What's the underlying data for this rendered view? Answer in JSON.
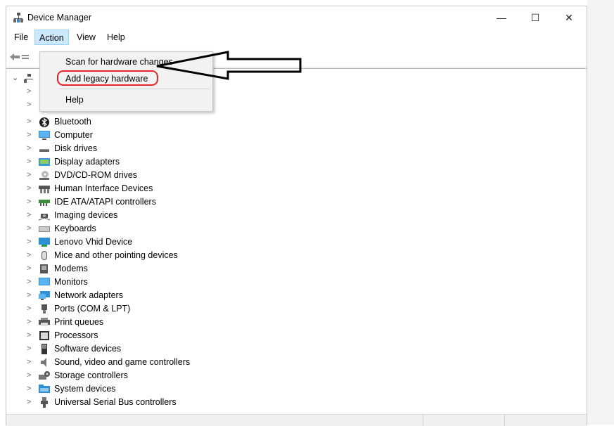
{
  "window": {
    "title": "Device Manager",
    "controls": {
      "minimize": "—",
      "maximize": "☐",
      "close": "✕"
    }
  },
  "menubar": {
    "items": [
      "File",
      "Action",
      "View",
      "Help"
    ],
    "active": "Action"
  },
  "dropdown": {
    "items": [
      "Scan for hardware changes",
      "Add legacy hardware",
      "Help"
    ],
    "highlighted": "Add legacy hardware"
  },
  "tree": {
    "items": [
      {
        "label": "Bluetooth",
        "icon": "bluetooth-icon"
      },
      {
        "label": "Computer",
        "icon": "computer-icon"
      },
      {
        "label": "Disk drives",
        "icon": "disk-drive-icon"
      },
      {
        "label": "Display adapters",
        "icon": "display-adapter-icon"
      },
      {
        "label": "DVD/CD-ROM drives",
        "icon": "dvd-drive-icon"
      },
      {
        "label": "Human Interface Devices",
        "icon": "hid-icon"
      },
      {
        "label": "IDE ATA/ATAPI controllers",
        "icon": "ide-controller-icon"
      },
      {
        "label": "Imaging devices",
        "icon": "imaging-device-icon"
      },
      {
        "label": "Keyboards",
        "icon": "keyboard-icon"
      },
      {
        "label": "Lenovo Vhid Device",
        "icon": "lenovo-device-icon"
      },
      {
        "label": "Mice and other pointing devices",
        "icon": "mouse-icon"
      },
      {
        "label": "Modems",
        "icon": "modem-icon"
      },
      {
        "label": "Monitors",
        "icon": "monitor-icon"
      },
      {
        "label": "Network adapters",
        "icon": "network-adapter-icon"
      },
      {
        "label": "Ports (COM & LPT)",
        "icon": "port-icon"
      },
      {
        "label": "Print queues",
        "icon": "printer-icon"
      },
      {
        "label": "Processors",
        "icon": "processor-icon"
      },
      {
        "label": "Software devices",
        "icon": "software-device-icon"
      },
      {
        "label": "Sound, video and game controllers",
        "icon": "speaker-icon"
      },
      {
        "label": "Storage controllers",
        "icon": "storage-controller-icon"
      },
      {
        "label": "System devices",
        "icon": "system-folder-icon"
      },
      {
        "label": "Universal Serial Bus controllers",
        "icon": "usb-icon"
      }
    ]
  },
  "colors": {
    "menu_active_bg": "#cce8ff",
    "annotation_red": "#e8232b",
    "annotation_arrow": "#000000"
  }
}
